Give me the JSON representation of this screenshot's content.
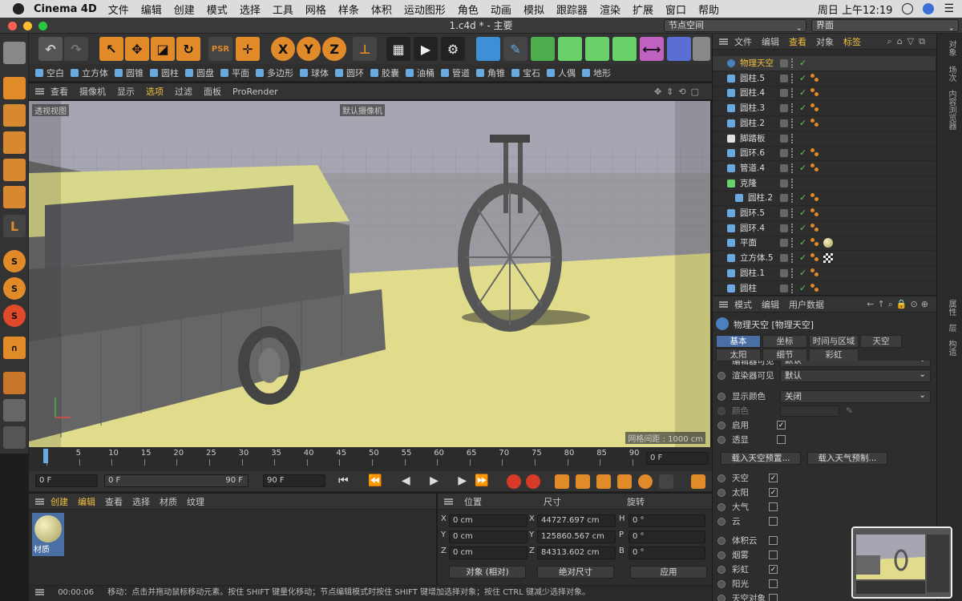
{
  "menubar": {
    "app": "Cinema 4D",
    "items": [
      "文件",
      "编辑",
      "创建",
      "模式",
      "选择",
      "工具",
      "网格",
      "样条",
      "体积",
      "运动图形",
      "角色",
      "动画",
      "模拟",
      "跟踪器",
      "渲染",
      "扩展",
      "窗口",
      "帮助"
    ],
    "clock": "周日 上午12:19"
  },
  "titlebar": {
    "title": "1.c4d * - 主要",
    "node_space": "节点空间",
    "layout": "界面"
  },
  "objbar": {
    "items": [
      "空白",
      "立方体",
      "圆锥",
      "圆柱",
      "圆盘",
      "平面",
      "多边形",
      "球体",
      "圆环",
      "胶囊",
      "油桶",
      "管道",
      "角锥",
      "宝石",
      "人偶",
      "地形"
    ]
  },
  "viewport": {
    "menu": [
      "查看",
      "摄像机",
      "显示",
      "选项",
      "过滤",
      "面板",
      "ProRender"
    ],
    "active_menu": "选项",
    "view_name": "透视视图",
    "camera": "默认摄像机",
    "grid_spacing": "网格间距 : 1000 cm"
  },
  "timeline": {
    "ticks": [
      "0",
      "5",
      "10",
      "15",
      "20",
      "25",
      "30",
      "35",
      "40",
      "45",
      "50",
      "55",
      "60",
      "65",
      "70",
      "75",
      "80",
      "85",
      "90"
    ],
    "current_frame": "0 F",
    "start": "0 F",
    "range_start": "0 F",
    "range_end": "90 F",
    "end": "90 F"
  },
  "materials": {
    "menu": [
      "创建",
      "编辑",
      "查看",
      "选择",
      "材质",
      "纹理"
    ],
    "item": "材质"
  },
  "coords": {
    "headers": [
      "位置",
      "尺寸",
      "旋转"
    ],
    "rows": [
      {
        "axis": "X",
        "pos": "0 cm",
        "saxis": "X",
        "size": "44727.697 cm",
        "raxis": "H",
        "rot": "0 °"
      },
      {
        "axis": "Y",
        "pos": "0 cm",
        "saxis": "Y",
        "size": "125860.567 cm",
        "raxis": "P",
        "rot": "0 °"
      },
      {
        "axis": "Z",
        "pos": "0 cm",
        "saxis": "Z",
        "size": "84313.602 cm",
        "raxis": "B",
        "rot": "0 °"
      }
    ],
    "mode": "对象 (相对)",
    "size_mode": "绝对尺寸",
    "apply": "应用"
  },
  "status": {
    "time": "00:00:06",
    "text": "移动：点击并拖动鼠标移动元素。按住 SHIFT 键量化移动；节点编辑模式时按住 SHIFT 键增加选择对象；按住 CTRL 键减少选择对象。"
  },
  "objmgr": {
    "menu": [
      "文件",
      "编辑",
      "查看",
      "对象",
      "标签"
    ],
    "rows": [
      {
        "name": "物理天空",
        "indent": 0
      },
      {
        "name": "圆柱.5",
        "indent": 0
      },
      {
        "name": "圆柱.4",
        "indent": 0
      },
      {
        "name": "圆柱.3",
        "indent": 0
      },
      {
        "name": "圆柱.2",
        "indent": 0
      },
      {
        "name": "脚踏板",
        "indent": 0
      },
      {
        "name": "圆环.6",
        "indent": 0
      },
      {
        "name": "管道.4",
        "indent": 0
      },
      {
        "name": "克隆",
        "indent": 0
      },
      {
        "name": "圆柱.2",
        "indent": 1
      },
      {
        "name": "圆环.5",
        "indent": 0
      },
      {
        "name": "圆环.4",
        "indent": 0
      },
      {
        "name": "平面",
        "indent": 0
      },
      {
        "name": "立方体.5",
        "indent": 0
      },
      {
        "name": "圆柱.1",
        "indent": 0
      },
      {
        "name": "圆柱",
        "indent": 0
      }
    ]
  },
  "attr": {
    "menu": [
      "模式",
      "编辑",
      "用户数据"
    ],
    "object_title": "物理天空 [物理天空]",
    "tabs": [
      "基本",
      "坐标",
      "时间与区域",
      "天空",
      "太阳",
      "细节",
      "彩虹"
    ],
    "editor_visible_label": "编辑器可见",
    "editor_visible_value": "默认",
    "render_visible_label": "渲染器可见",
    "render_visible_value": "默认",
    "display_color_label": "显示颜色",
    "display_color_value": "关闭",
    "color_label": "颜色",
    "enable_label": "启用",
    "transparent_label": "透显",
    "load_sky_preset": "载入天空预置...",
    "load_weather_preset": "载入天气预制...",
    "checks": [
      {
        "label": "天空",
        "checked": true
      },
      {
        "label": "太阳",
        "checked": true
      },
      {
        "label": "大气",
        "checked": false
      },
      {
        "label": "云",
        "checked": false
      }
    ],
    "checks2": [
      {
        "label": "体积云",
        "checked": false
      },
      {
        "label": "烟雾",
        "checked": false
      },
      {
        "label": "彩虹",
        "checked": true
      },
      {
        "label": "阳光",
        "checked": false
      },
      {
        "label": "天空对象",
        "checked": false
      }
    ]
  },
  "rstrip": [
    "对象",
    "场次",
    "内容浏览器",
    "属性",
    "层",
    "构造"
  ]
}
